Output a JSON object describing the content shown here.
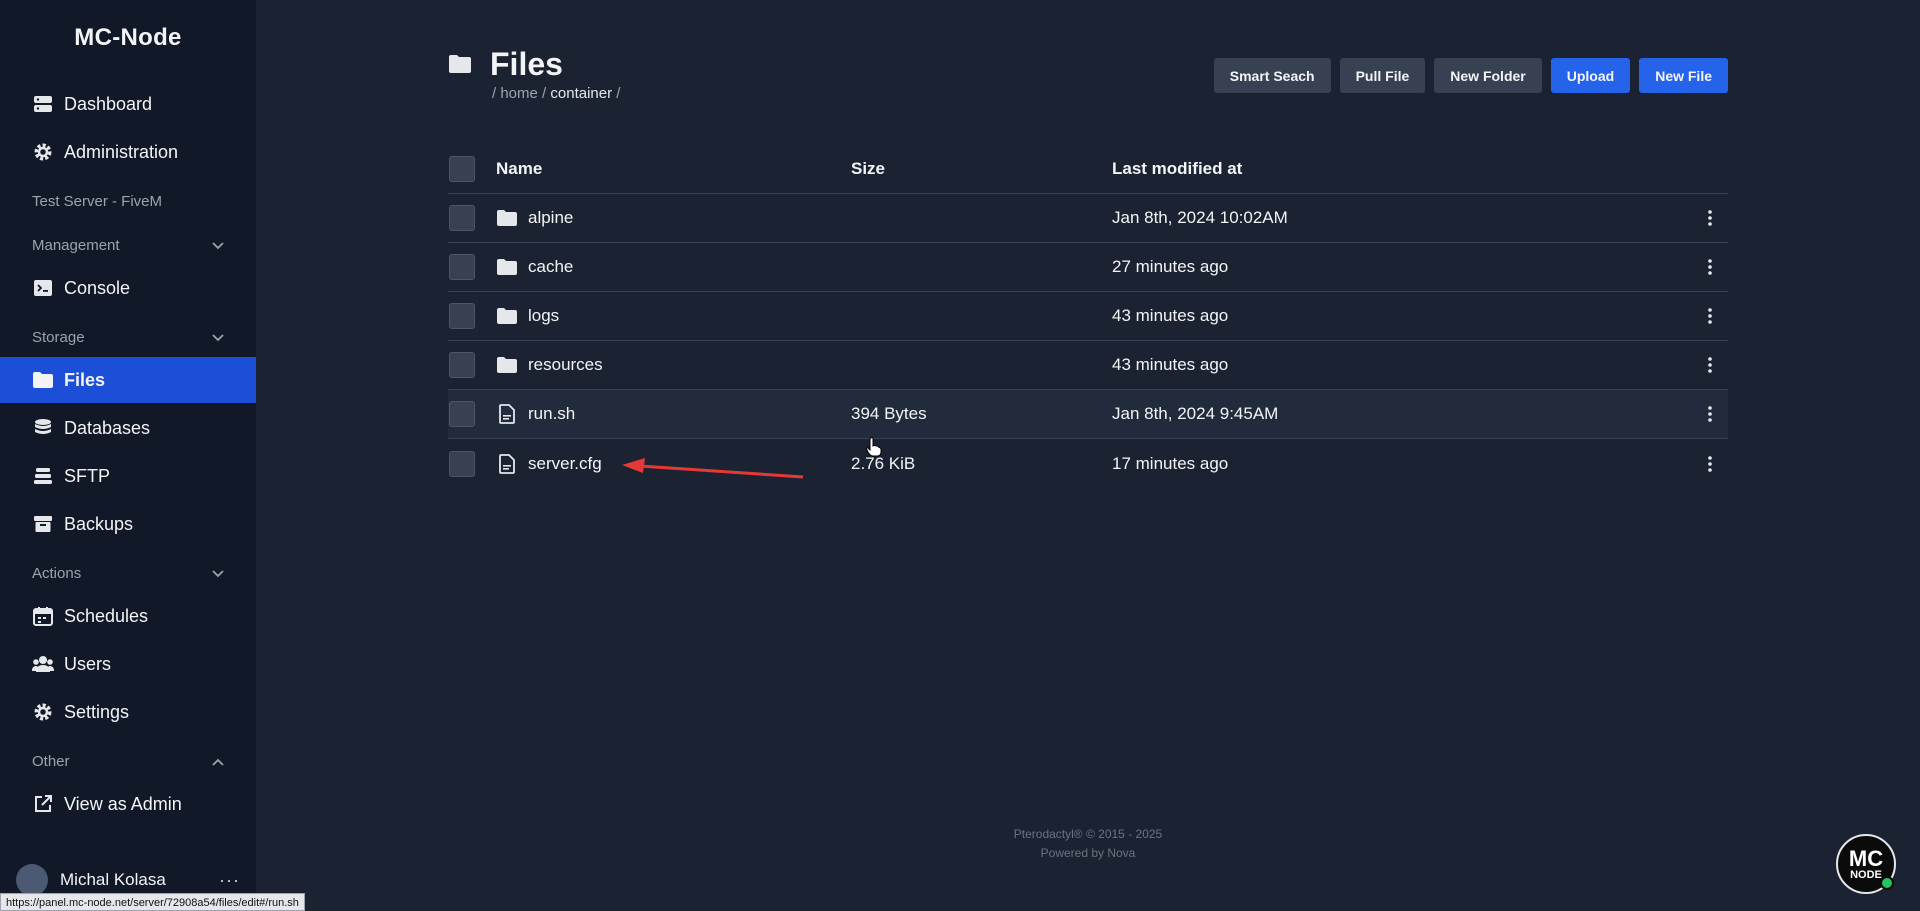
{
  "sidebar": {
    "brand": "MC-Node",
    "top_items": [
      {
        "label": "Dashboard",
        "icon": "server-stack-icon"
      },
      {
        "label": "Administration",
        "icon": "gear-icon"
      }
    ],
    "server_name": "Test Server - FiveM",
    "sections": {
      "management": {
        "label": "Management",
        "items": [
          {
            "label": "Console",
            "icon": "terminal-icon"
          }
        ]
      },
      "storage": {
        "label": "Storage",
        "items": [
          {
            "label": "Files",
            "icon": "folder-icon",
            "active": true
          },
          {
            "label": "Databases",
            "icon": "database-icon"
          },
          {
            "label": "SFTP",
            "icon": "layers-icon"
          },
          {
            "label": "Backups",
            "icon": "archive-box-icon"
          }
        ]
      },
      "actions": {
        "label": "Actions",
        "items": [
          {
            "label": "Schedules",
            "icon": "calendar-icon"
          },
          {
            "label": "Users",
            "icon": "users-icon"
          },
          {
            "label": "Settings",
            "icon": "gear-icon"
          }
        ]
      },
      "other": {
        "label": "Other",
        "items": [
          {
            "label": "View as Admin",
            "icon": "external-link-icon"
          }
        ]
      }
    },
    "user": {
      "name": "Michal Kolasa",
      "more": "···"
    }
  },
  "header": {
    "title": "Files",
    "breadcrumb": {
      "sep1": "/",
      "home": "home",
      "sep2": "/",
      "current": "container",
      "sep3": "/"
    }
  },
  "toolbar": {
    "smart_search": "Smart Seach",
    "pull_file": "Pull File",
    "new_folder": "New Folder",
    "upload": "Upload",
    "new_file": "New File"
  },
  "table": {
    "headers": {
      "name": "Name",
      "size": "Size",
      "modified": "Last modified at"
    },
    "rows": [
      {
        "name": "alpine",
        "type": "folder",
        "size": "",
        "modified": "Jan 8th, 2024 10:02AM"
      },
      {
        "name": "cache",
        "type": "folder",
        "size": "",
        "modified": "27 minutes ago"
      },
      {
        "name": "logs",
        "type": "folder",
        "size": "",
        "modified": "43 minutes ago"
      },
      {
        "name": "resources",
        "type": "folder",
        "size": "",
        "modified": "43 minutes ago"
      },
      {
        "name": "run.sh",
        "type": "file",
        "size": "394 Bytes",
        "modified": "Jan 8th, 2024 9:45AM"
      },
      {
        "name": "server.cfg",
        "type": "file",
        "size": "2.76 KiB",
        "modified": "17 minutes ago"
      }
    ]
  },
  "footer": {
    "line1": "Pterodactyl® © 2015 - 2025",
    "line2": "Powered by Nova"
  },
  "corner_logo": {
    "line1": "MC",
    "line2": "NODE"
  },
  "status_url": "https://panel.mc-node.net/server/72908a54/files/edit#/run.sh",
  "colors": {
    "accent": "#2563eb",
    "active_nav": "#1d4ed8",
    "annotation_arrow": "#e53935",
    "online": "#22c55e"
  }
}
